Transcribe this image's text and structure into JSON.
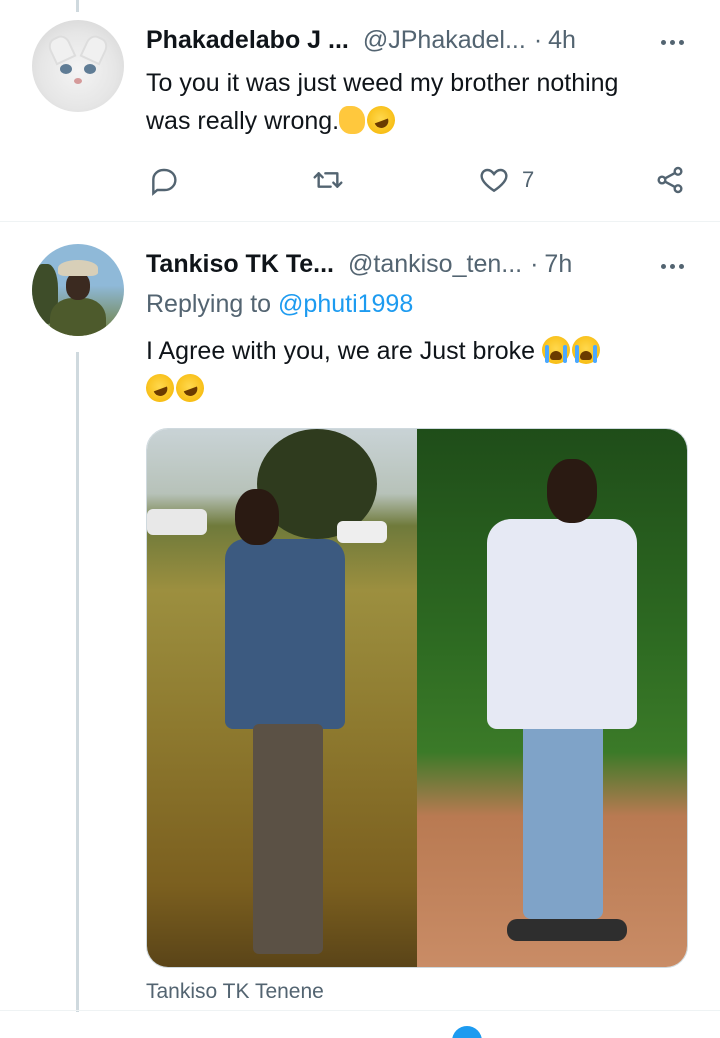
{
  "tweets": [
    {
      "name": "Phakadelabo J ...",
      "handle": "@JPhakadel...",
      "dot": "·",
      "time": "4h",
      "text_line1": "To you it was just weed my brother nothing",
      "text_line2": "was really wrong.",
      "emojis": [
        "thumbs-up-emoji",
        "rolling-laughing-emoji"
      ],
      "actions": {
        "reply_count": "",
        "retweet_count": "",
        "like_count": "7"
      },
      "avatar_icon": "white-cat-avatar"
    },
    {
      "name": "Tankiso TK Te...",
      "handle": "@tankiso_ten...",
      "dot": "·",
      "time": "7h",
      "replying_prefix": "Replying to ",
      "replying_mention": "@phuti1998",
      "text_line1": "I Agree with you, we are Just broke",
      "emojis_line1": [
        "loudly-crying-emoji",
        "loudly-crying-emoji"
      ],
      "emojis_line2": [
        "rolling-laughing-emoji",
        "rolling-laughing-emoji"
      ],
      "media_caption": "Tankiso TK Tenene",
      "avatar_icon": "man-with-hat-avatar"
    }
  ],
  "colors": {
    "accent": "#1d9bf0",
    "secondary_text": "#536471",
    "primary_text": "#0f1419",
    "divider": "#eff3f4"
  }
}
